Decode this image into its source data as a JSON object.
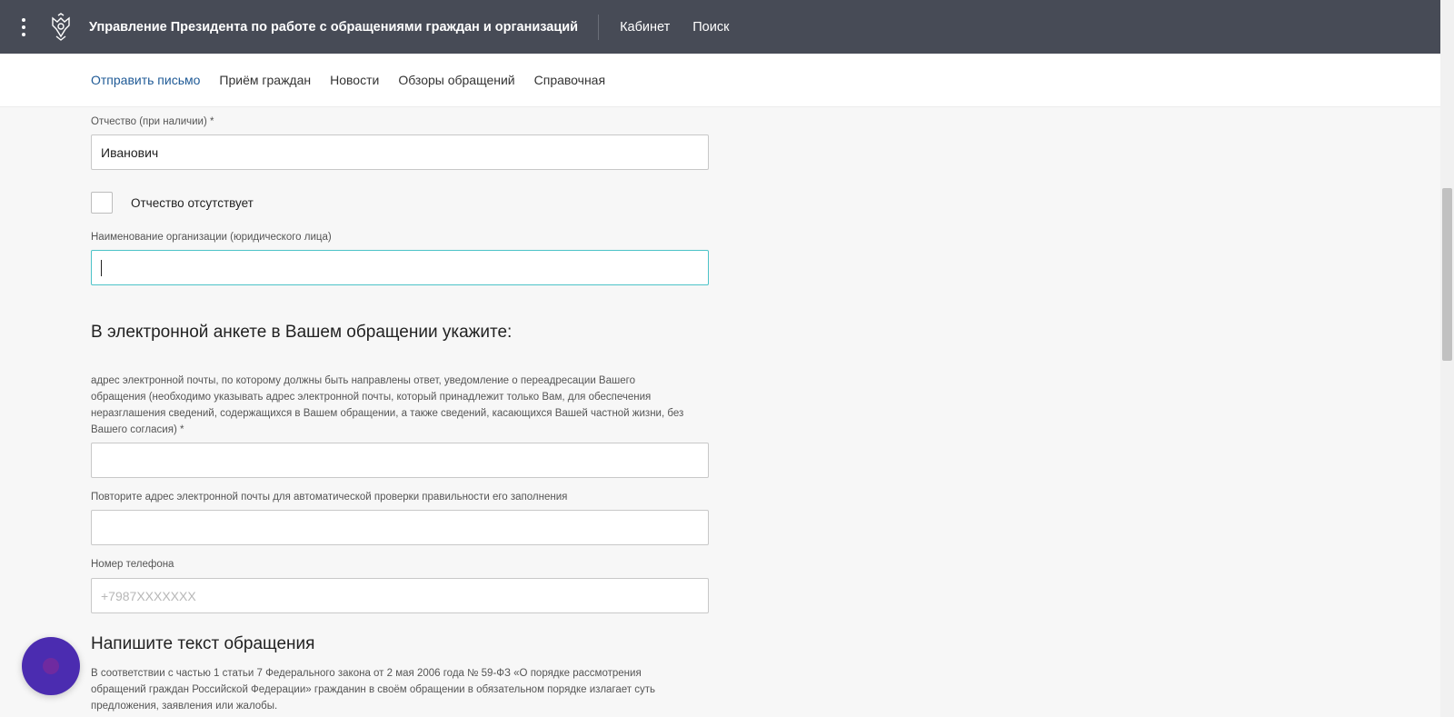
{
  "header": {
    "site_title": "Управление Президента по работе с обращениями граждан и организаций",
    "links": [
      "Кабинет",
      "Поиск"
    ]
  },
  "subnav": {
    "items": [
      "Отправить письмо",
      "Приём граждан",
      "Новости",
      "Обзоры обращений",
      "Справочная"
    ],
    "active_index": 0
  },
  "form": {
    "patronymic_label": "Отчество (при наличии) *",
    "patronymic_value": "Иванович",
    "no_patronymic_label": "Отчество отсутствует",
    "no_patronymic_checked": false,
    "org_label": "Наименование организации (юридического лица)",
    "org_value": "",
    "section_heading": "В электронной анкете в Вашем обращении укажите:",
    "email_label": "адрес электронной почты, по которому должны быть направлены ответ, уведомление о переадресации Вашего обращения (необходимо указывать адрес электронной почты, который принадлежит только Вам, для обеспечения неразглашения сведений, содержащихся в Вашем обращении, а также сведений, касающихся Вашей частной жизни, без Вашего согласия) *",
    "email_value": "",
    "email_repeat_label": "Повторите адрес электронной почты для автоматической проверки правильности его заполнения",
    "email_repeat_value": "",
    "phone_label": "Номер телефона",
    "phone_placeholder": "+7987XXXXXXX",
    "text_heading": "Напишите текст обращения",
    "text_paragraph": "В соответствии с частью 1 статьи 7 Федерального закона от 2 мая 2006 года № 59-ФЗ «О порядке рассмотрения обращений граждан Российской Федерации» гражданин в своём обращении в обязательном порядке излагает суть предложения, заявления или жалобы."
  },
  "icons": {
    "menu": "kebab-menu-icon",
    "emblem": "coat-of-arms-icon",
    "chat": "chat-bubble-icon"
  },
  "colors": {
    "topbar": "#474b56",
    "active_link": "#1f5a96",
    "focus_border": "#4cc3c8",
    "chat_fab": "#4b2cb0"
  }
}
